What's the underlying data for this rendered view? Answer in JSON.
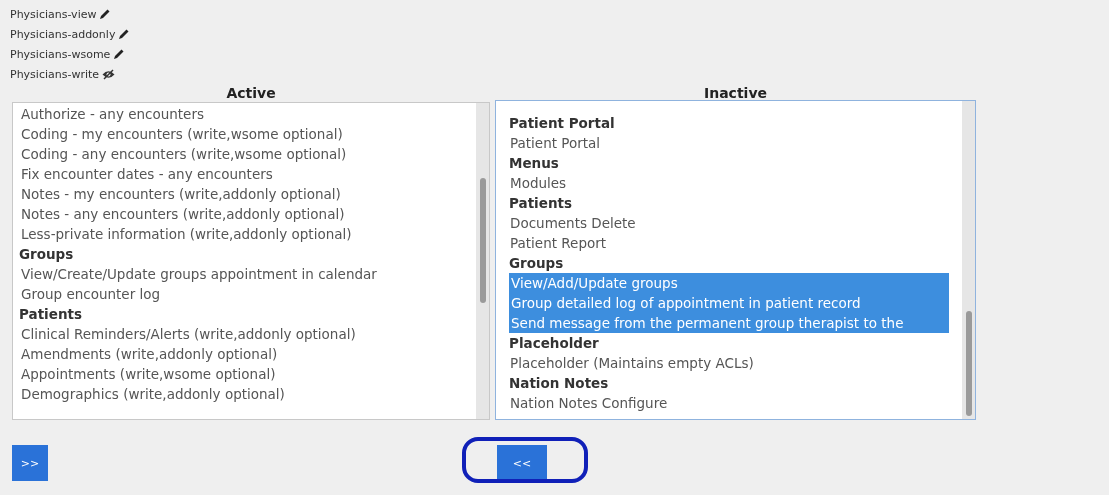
{
  "acl_groups": [
    {
      "label": "Physicians-view",
      "kind": "editable"
    },
    {
      "label": "Physicians-addonly",
      "kind": "editable"
    },
    {
      "label": "Physicians-wsome",
      "kind": "editable"
    },
    {
      "label": "Physicians-write",
      "kind": "hidden"
    }
  ],
  "lists": [
    {
      "title": "Active",
      "items": [
        {
          "kind": "item",
          "label": "Authorize - any encounters",
          "selected": false
        },
        {
          "kind": "item",
          "label": "Coding - my encounters (write,wsome optional)",
          "selected": false
        },
        {
          "kind": "item",
          "label": "Coding - any encounters (write,wsome optional)",
          "selected": false
        },
        {
          "kind": "item",
          "label": "Fix encounter dates - any encounters",
          "selected": false
        },
        {
          "kind": "item",
          "label": "Notes - my encounters (write,addonly optional)",
          "selected": false
        },
        {
          "kind": "item",
          "label": "Notes - any encounters (write,addonly optional)",
          "selected": false
        },
        {
          "kind": "item",
          "label": "Less-private information (write,addonly optional)",
          "selected": false
        },
        {
          "kind": "group",
          "label": "Groups"
        },
        {
          "kind": "item",
          "label": "View/Create/Update groups appointment in calendar",
          "selected": false
        },
        {
          "kind": "item",
          "label": "Group encounter log",
          "selected": false
        },
        {
          "kind": "group",
          "label": "Patients"
        },
        {
          "kind": "item",
          "label": "Clinical Reminders/Alerts (write,addonly optional)",
          "selected": false
        },
        {
          "kind": "item",
          "label": "Amendments (write,addonly optional)",
          "selected": false
        },
        {
          "kind": "item",
          "label": "Appointments (write,wsome optional)",
          "selected": false
        },
        {
          "kind": "item",
          "label": "Demographics (write,addonly optional)",
          "selected": false
        }
      ]
    },
    {
      "title": "Inactive",
      "items": [
        {
          "kind": "group",
          "label": "Patient Portal"
        },
        {
          "kind": "item",
          "label": "Patient Portal",
          "selected": false
        },
        {
          "kind": "group",
          "label": "Menus"
        },
        {
          "kind": "item",
          "label": "Modules",
          "selected": false
        },
        {
          "kind": "group",
          "label": "Patients"
        },
        {
          "kind": "item",
          "label": "Documents Delete",
          "selected": false
        },
        {
          "kind": "item",
          "label": "Patient Report",
          "selected": false
        },
        {
          "kind": "group",
          "label": "Groups"
        },
        {
          "kind": "item",
          "label": "View/Add/Update groups",
          "selected": true
        },
        {
          "kind": "item",
          "label": "Group detailed log of appointment in patient record",
          "selected": true
        },
        {
          "kind": "item",
          "label": "Send message from the permanent group therapist to the",
          "selected": true
        },
        {
          "kind": "group",
          "label": "Placeholder"
        },
        {
          "kind": "item",
          "label": "Placeholder (Maintains empty ACLs)",
          "selected": false
        },
        {
          "kind": "group",
          "label": "Nation Notes"
        },
        {
          "kind": "item",
          "label": "Nation Notes Configure",
          "selected": false
        }
      ]
    }
  ],
  "buttons": [
    {
      "label": ">>"
    },
    {
      "label": "<<"
    }
  ]
}
